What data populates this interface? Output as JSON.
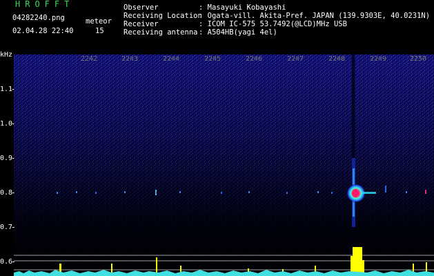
{
  "header": {
    "logo": "HROFFT",
    "filename": "04282240.png",
    "datetime": "02.04.28 22:40",
    "meteor_label": "meteor",
    "meteor_count": "15",
    "fields": [
      {
        "label": "Observer",
        "value": ": Masayuki Kobayashi"
      },
      {
        "label": "Receiving Location",
        "value": ": Ogata-vill. Akita-Pref. JAPAN (139.9303E, 40.0231N)"
      },
      {
        "label": "Receiver",
        "value": ": ICOM IC-575 53.7492(@LCD)MHz USB"
      },
      {
        "label": "Receiving antenna",
        "value": ": A504HB(yagi 4el)"
      }
    ]
  },
  "axis": {
    "unit": "kHz",
    "y_labels": [
      "1.1",
      "1.0",
      "0.9",
      "0.8",
      "0.7",
      "0.6"
    ],
    "time_labels": [
      "2242",
      "2243",
      "2244",
      "2245",
      "2246",
      "2247",
      "2248",
      "2249",
      "2250"
    ]
  },
  "colors": {
    "noise": "#1010a0",
    "echo_core": "#ff2080",
    "echo_halo": "#40ffe0",
    "bars": "#ffff00",
    "axis_text": "#ffff00"
  }
}
